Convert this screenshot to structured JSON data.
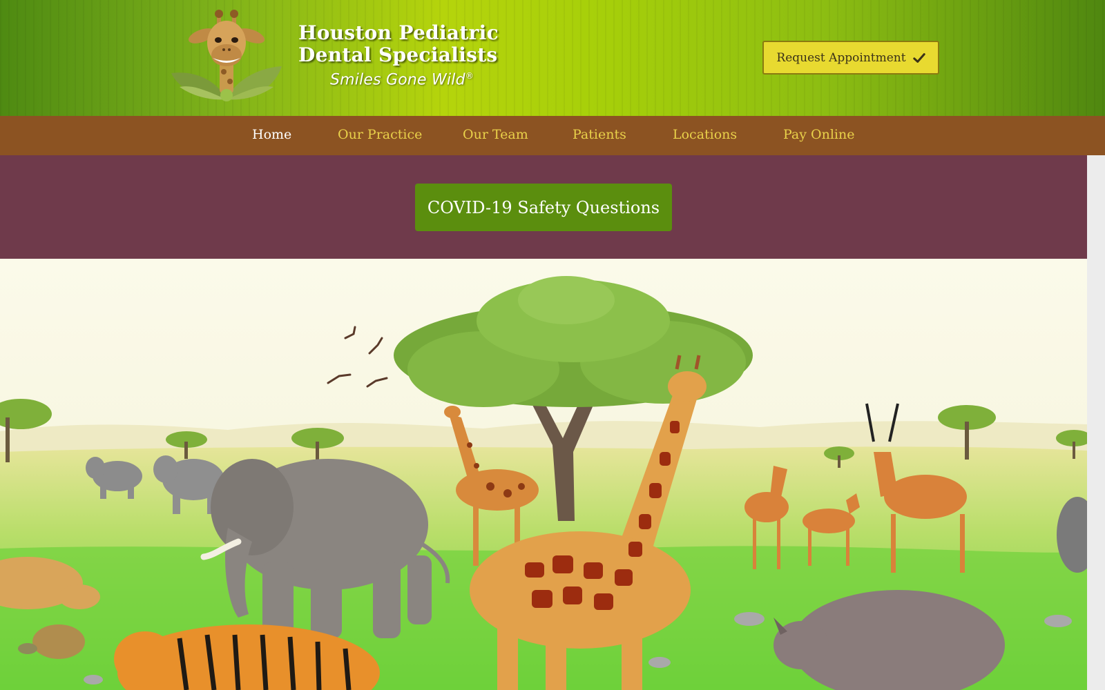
{
  "brand": {
    "name_line1": "Houston Pediatric",
    "name_line2": "Dental Specialists",
    "tagline": "Smiles Gone Wild",
    "tagline_mark": "®",
    "logo_icon": "giraffe-logo-icon"
  },
  "header": {
    "request_button_label": "Request Appointment",
    "request_button_icon": "checkmark-icon"
  },
  "nav": {
    "items": [
      {
        "label": "Home",
        "active": true
      },
      {
        "label": "Our Practice",
        "active": false
      },
      {
        "label": "Our Team",
        "active": false
      },
      {
        "label": "Patients",
        "active": false
      },
      {
        "label": "Locations",
        "active": false
      },
      {
        "label": "Pay Online",
        "active": false
      }
    ]
  },
  "notice": {
    "covid_button_label": "COVID-19 Safety Questions"
  },
  "hero": {
    "scene": "savanna-illustration"
  },
  "colors": {
    "header_green": "#a6cf0a",
    "nav_brown": "#8c5322",
    "nav_link": "#e9d14a",
    "band_plum": "#6f3a4b",
    "covid_green": "#5b8e0e",
    "request_yellow": "#e8da30"
  }
}
